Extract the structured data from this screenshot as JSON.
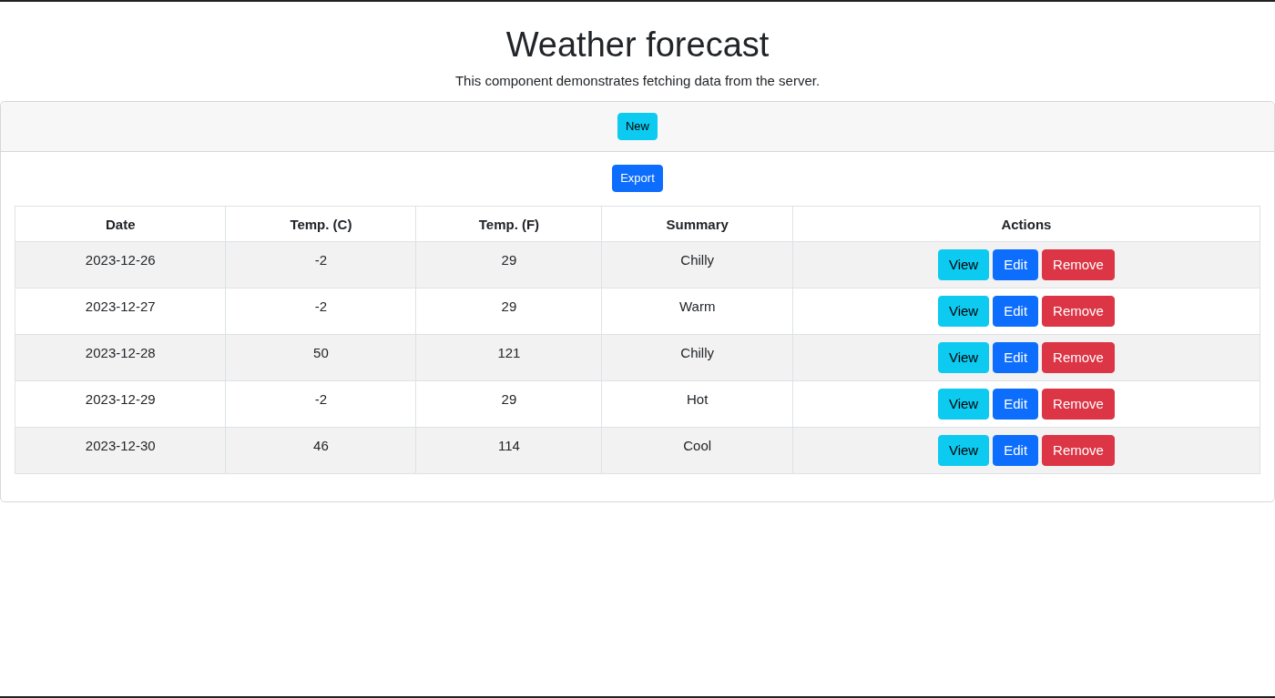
{
  "title": "Weather forecast",
  "subtitle": "This component demonstrates fetching data from the server.",
  "header_button": "New",
  "export_button": "Export",
  "table": {
    "columns": [
      "Date",
      "Temp. (C)",
      "Temp. (F)",
      "Summary",
      "Actions"
    ],
    "rows": [
      {
        "date": "2023-12-26",
        "temp_c": "-2",
        "temp_f": "29",
        "summary": "Chilly",
        "actions": [
          {
            "kind": "view",
            "label": "View"
          },
          {
            "kind": "edit",
            "label": "Edit"
          },
          {
            "kind": "remove",
            "label": "Remove"
          }
        ]
      },
      {
        "date": "2023-12-27",
        "temp_c": "-2",
        "temp_f": "29",
        "summary": "Warm",
        "actions": [
          {
            "kind": "view",
            "label": "View"
          },
          {
            "kind": "edit",
            "label": "Edit"
          },
          {
            "kind": "remove",
            "label": "Remove"
          }
        ]
      },
      {
        "date": "2023-12-28",
        "temp_c": "50",
        "temp_f": "121",
        "summary": "Chilly",
        "actions": [
          {
            "kind": "view",
            "label": "View"
          },
          {
            "kind": "edit",
            "label": "Edit"
          },
          {
            "kind": "remove",
            "label": "Remove"
          }
        ]
      },
      {
        "date": "2023-12-29",
        "temp_c": "-2",
        "temp_f": "29",
        "summary": "Hot",
        "actions": [
          {
            "kind": "view",
            "label": "View"
          },
          {
            "kind": "edit",
            "label": "Edit"
          },
          {
            "kind": "remove",
            "label": "Remove"
          }
        ]
      },
      {
        "date": "2023-12-30",
        "temp_c": "46",
        "temp_f": "114",
        "summary": "Cool",
        "actions": [
          {
            "kind": "view",
            "label": "View"
          },
          {
            "kind": "edit",
            "label": "Edit"
          },
          {
            "kind": "remove",
            "label": "Remove"
          }
        ]
      }
    ]
  }
}
